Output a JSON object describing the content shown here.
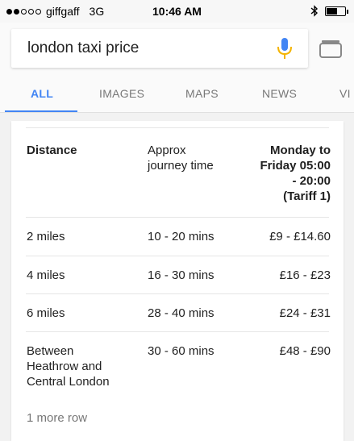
{
  "status_bar": {
    "carrier": "giffgaff",
    "network": "3G",
    "time": "10:46 AM",
    "signal_bars_filled": 2,
    "signal_bars_total": 5,
    "bluetooth_icon": "bluetooth-icon",
    "battery_level": 0.6
  },
  "search": {
    "query": "london taxi price",
    "mic_icon": "mic-icon",
    "tabs_icon": "tabs-icon"
  },
  "tabs": [
    {
      "label": "ALL",
      "active": true
    },
    {
      "label": "IMAGES",
      "active": false
    },
    {
      "label": "MAPS",
      "active": false
    },
    {
      "label": "NEWS",
      "active": false
    },
    {
      "label": "VI",
      "active": false
    }
  ],
  "table": {
    "headers": {
      "distance": "Distance",
      "time_line1": "Approx",
      "time_line2": "journey time",
      "price_line1": "Monday to",
      "price_line2": "Friday 05:00",
      "price_line3": "- 20:00",
      "price_line4": "(Tariff 1)"
    },
    "rows": [
      {
        "distance": [
          "2 miles"
        ],
        "time": "10 - 20 mins",
        "price": "£9 - £14.60"
      },
      {
        "distance": [
          "4 miles"
        ],
        "time": "16 - 30 mins",
        "price": "£16 - £23"
      },
      {
        "distance": [
          "6 miles"
        ],
        "time": "28 - 40 mins",
        "price": "£24 - £31"
      },
      {
        "distance": [
          "Between",
          "Heathrow and",
          "Central London"
        ],
        "time": "30 - 60 mins",
        "price": "£48 - £90"
      }
    ],
    "more_rows": "1 more row"
  },
  "colors": {
    "accent": "#4285f4",
    "mic_blue": "#4285f4",
    "mic_orange": "#f4b400"
  }
}
